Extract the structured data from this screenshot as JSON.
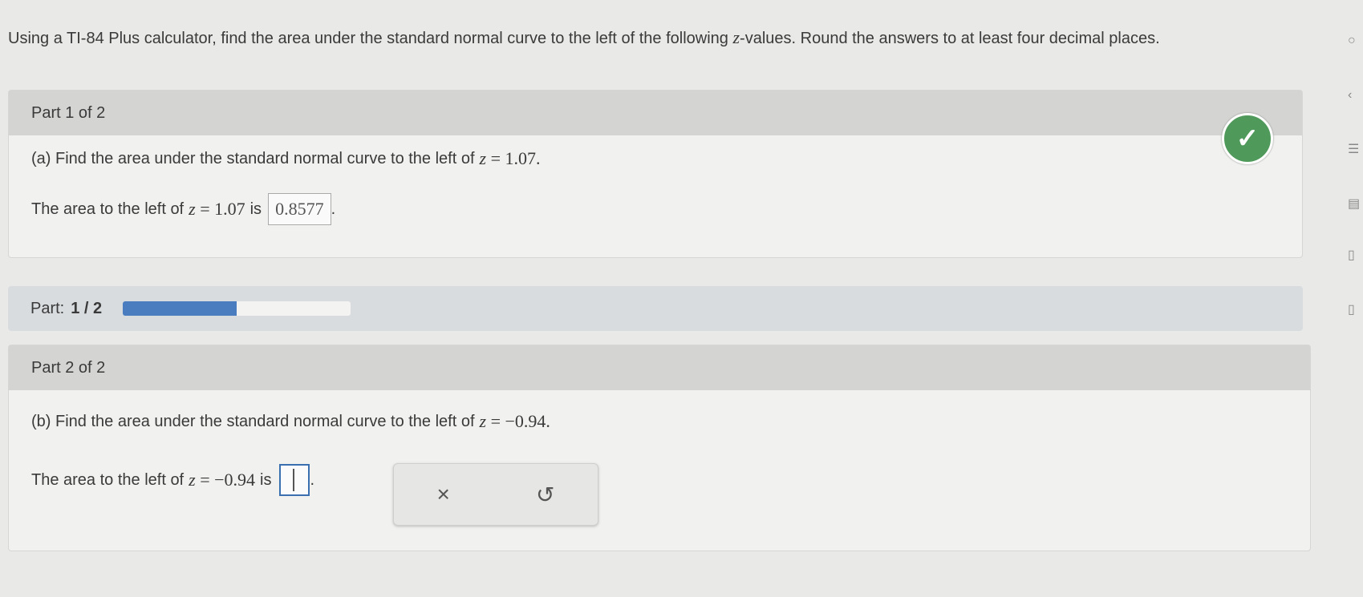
{
  "instructions": {
    "prefix": "Using a TI-84 Plus calculator, find the area under the standard normal curve to the left of the following ",
    "var": "z",
    "suffix": "-values. Round the answers to at least four decimal places."
  },
  "part1": {
    "header": "Part 1 of 2",
    "question_prefix": "(a) Find the area under the standard normal curve to the left of ",
    "question_math": "= 1.07.",
    "answer_prefix": "The area to the left of ",
    "answer_math": "= 1.07",
    "answer_is": "is",
    "answer_value": "0.8577",
    "answer_end": "."
  },
  "progress": {
    "label": "Part:",
    "count": "1 / 2",
    "fraction": 0.5
  },
  "part2": {
    "header": "Part 2 of 2",
    "question_prefix": "(b) Find the area under the standard normal curve to the left of ",
    "question_math": "= −0.94.",
    "answer_prefix": "The area to the left of ",
    "answer_math": "= −0.94",
    "answer_is": "is",
    "answer_end": "."
  },
  "tools": {
    "clear": "×",
    "undo": "↺"
  },
  "colors": {
    "check": "#4f9a5b",
    "progress": "#4a7dbf"
  }
}
